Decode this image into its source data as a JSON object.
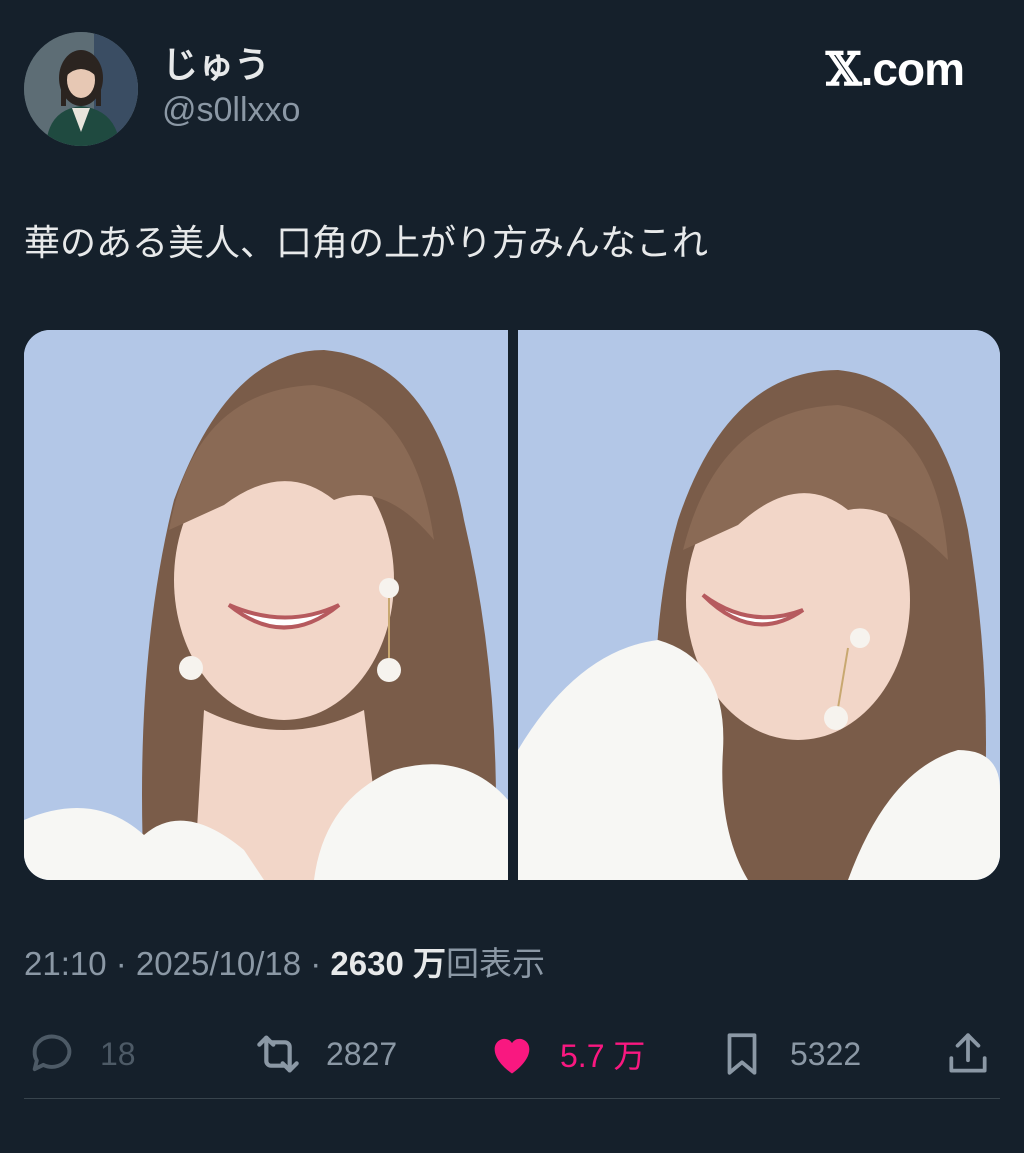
{
  "user": {
    "display_name": "じゅう",
    "handle": "@s0llxxo",
    "avatar": "avatar-photo"
  },
  "brand": {
    "x_glyph": "𝕏",
    "suffix": ".com"
  },
  "tweet": {
    "text": "華のある美人、口角の上がり方みんなこれ",
    "media": [
      "photo-smiling-woman-left",
      "photo-smiling-woman-right"
    ]
  },
  "meta": {
    "time": "21:10",
    "sep1": " · ",
    "date": "2025/10/18",
    "sep2": " · ",
    "views_count": "2630 万",
    "views_label": "回表示"
  },
  "actions": {
    "reply_count": "18",
    "retweet_count": "2827",
    "like_count": "5.7 万",
    "bookmark_count": "5322"
  },
  "colors": {
    "background": "#15202b",
    "text": "#e7e9ea",
    "secondary": "#8b98a5",
    "like": "#f91880",
    "photo_bg": "#b2c6e6"
  }
}
